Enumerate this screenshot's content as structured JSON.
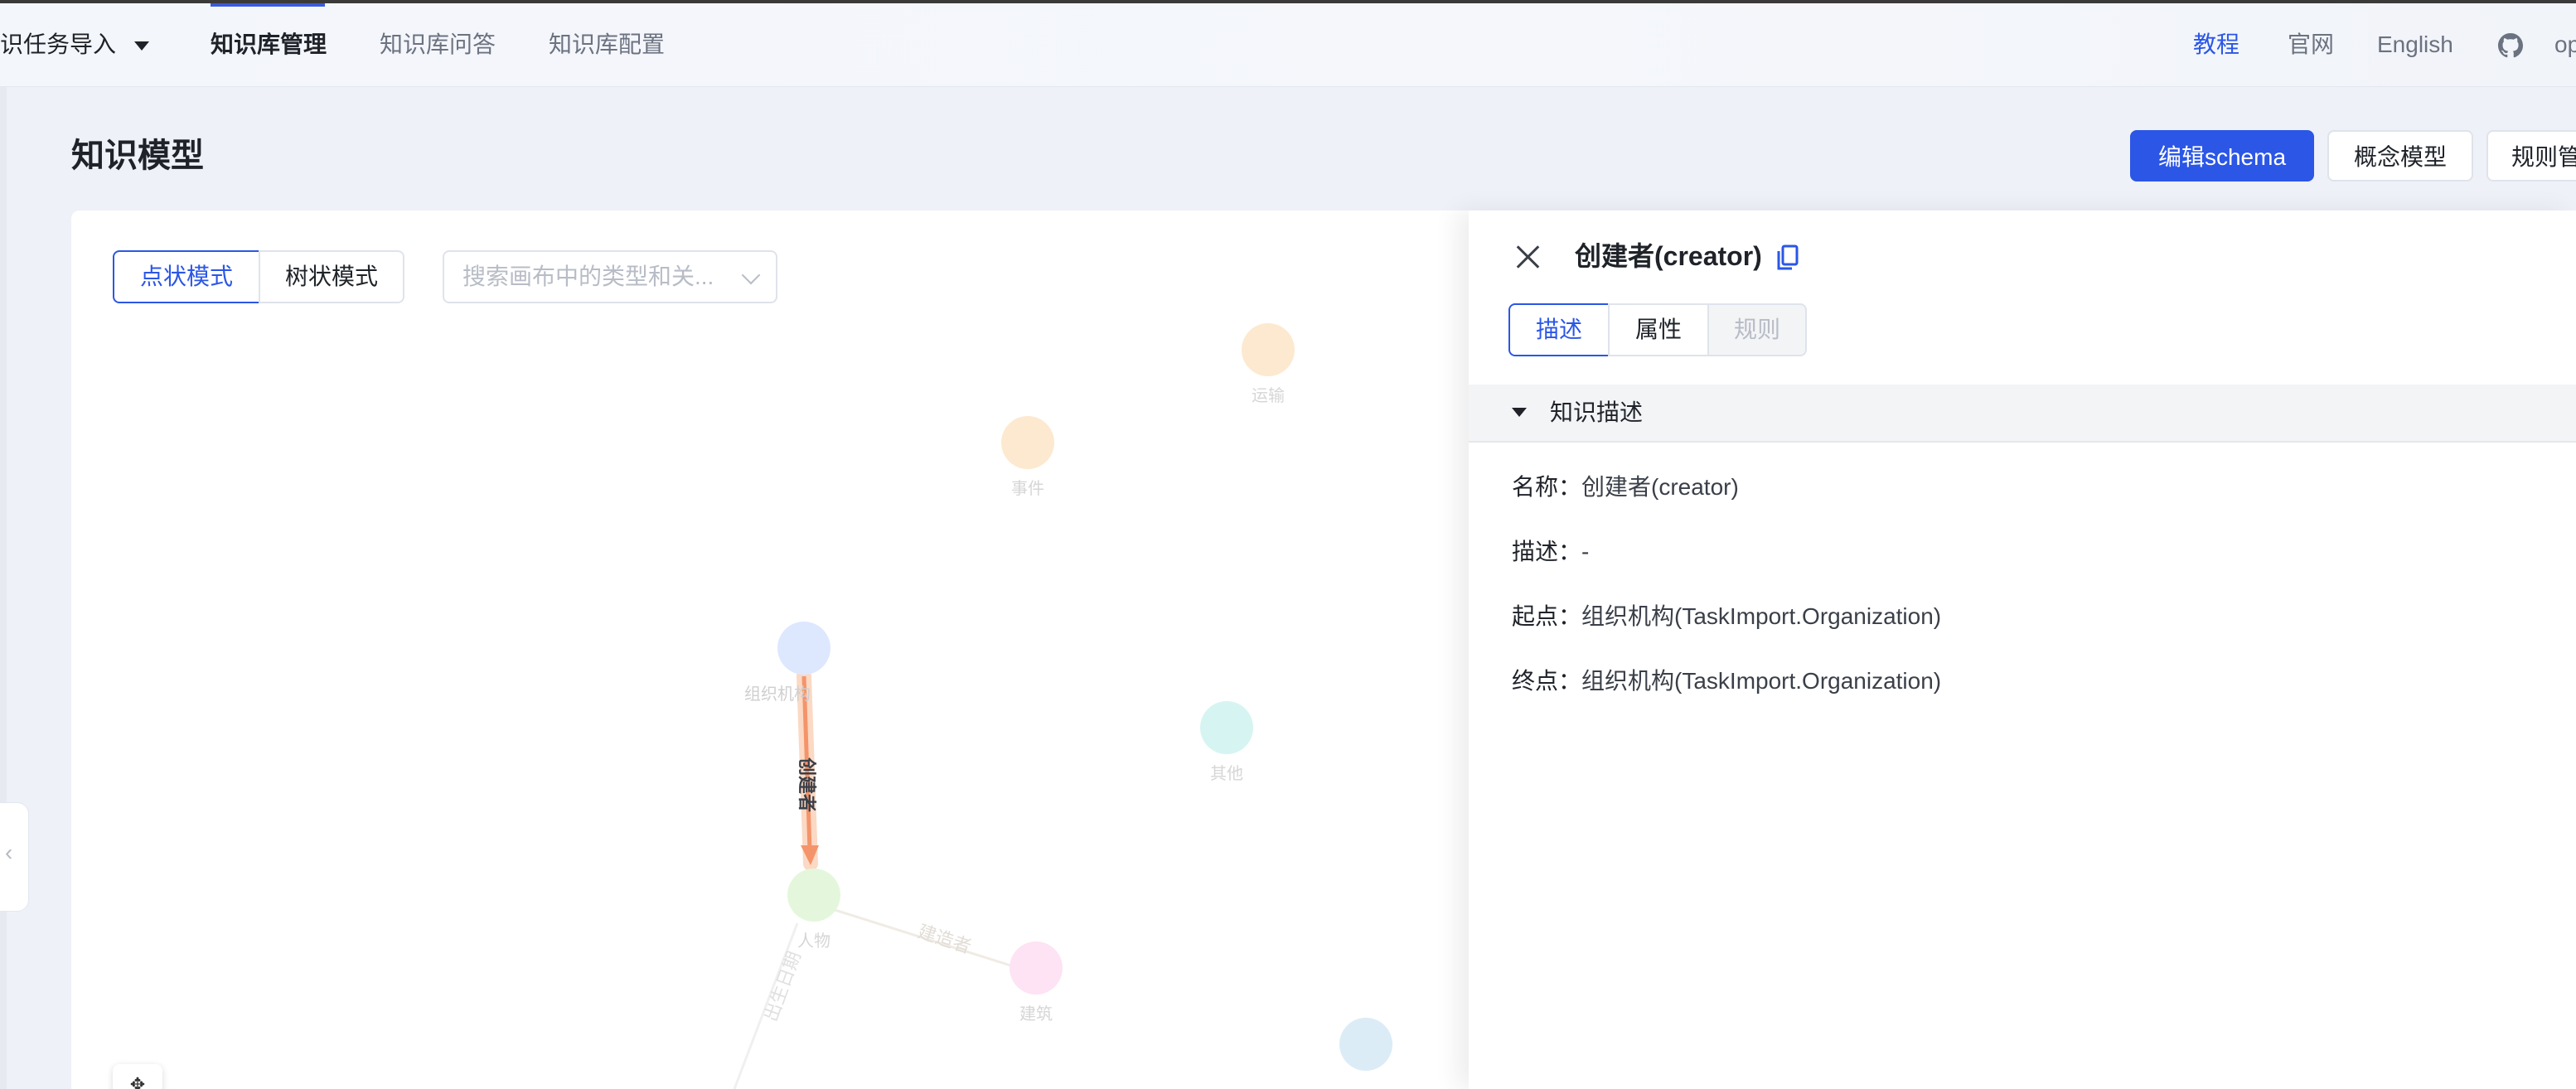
{
  "topbar": {
    "project": "识任务导入",
    "nav": [
      {
        "label": "知识库管理",
        "active": true
      },
      {
        "label": "知识库问答",
        "active": false
      },
      {
        "label": "知识库配置",
        "active": false
      }
    ],
    "right": {
      "tutorial": "教程",
      "website": "官网",
      "language": "English",
      "github_icon": "github-icon",
      "user_truncated": "op"
    }
  },
  "page": {
    "title": "知识模型",
    "buttons": {
      "edit_schema": "编辑schema",
      "concept_model": "概念模型",
      "rule_manage": "规则管"
    }
  },
  "canvas": {
    "mode_point": "点状模式",
    "mode_tree": "树状模式",
    "search_placeholder": "搜索画布中的类型和关...",
    "nodes": [
      {
        "id": "transport",
        "label": "运输",
        "color": "#fde9cf"
      },
      {
        "id": "event",
        "label": "事件",
        "color": "#fde9cf"
      },
      {
        "id": "org",
        "label": "组织机构",
        "color": "#dde8ff"
      },
      {
        "id": "other",
        "label": "其他",
        "color": "#d6f4f2"
      },
      {
        "id": "person",
        "label": "人物",
        "color": "#e4f7dc"
      },
      {
        "id": "building",
        "label": "建筑",
        "color": "#fde3f3"
      },
      {
        "id": "partial",
        "label": "",
        "color": "#dcecf6"
      }
    ],
    "edges": [
      {
        "label": "创建者",
        "highlight": true
      },
      {
        "label": "建造者",
        "highlight": false
      },
      {
        "label": "出生日期",
        "highlight": false
      }
    ]
  },
  "drawer": {
    "title": "创建者(creator)",
    "tabs": [
      "描述",
      "属性",
      "规则"
    ],
    "section": "知识描述",
    "fields": [
      {
        "key": "名称：",
        "value": "创建者(creator)"
      },
      {
        "key": "描述：",
        "value": "-"
      },
      {
        "key": "起点：",
        "value": "组织机构(TaskImport.Organization)"
      },
      {
        "key": "终点：",
        "value": "组织机构(TaskImport.Organization)"
      }
    ]
  }
}
